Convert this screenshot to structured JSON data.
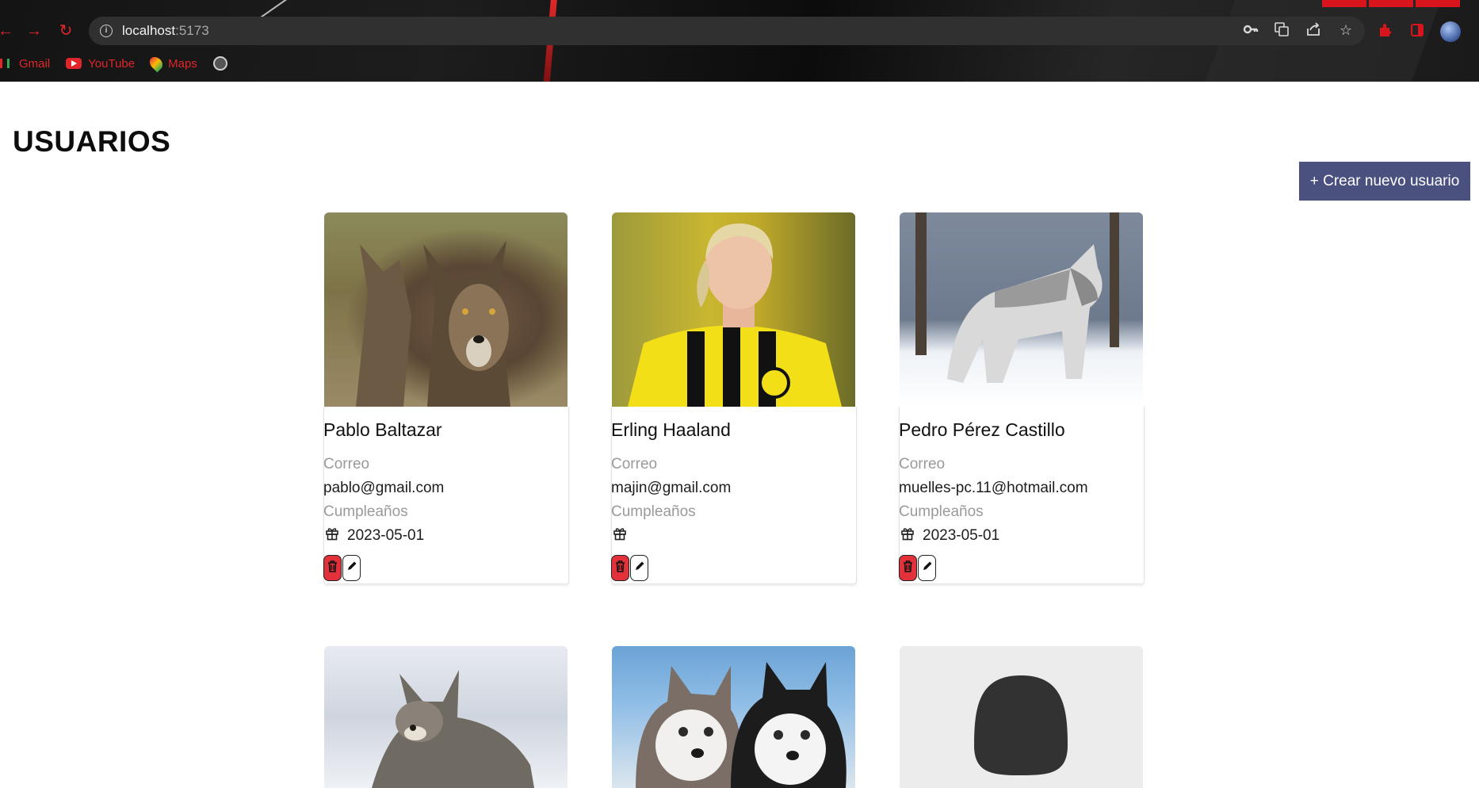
{
  "browser": {
    "url_host": "localhost",
    "url_port": ":5173",
    "bookmarks": [
      {
        "label": "Gmail",
        "icon": "gmail-icon"
      },
      {
        "label": "YouTube",
        "icon": "youtube-icon"
      },
      {
        "label": "Maps",
        "icon": "maps-icon"
      }
    ]
  },
  "page": {
    "title": "USUARIOS",
    "create_button": "+ Crear nuevo usuario"
  },
  "labels": {
    "email": "Correo",
    "birthday": "Cumpleaños"
  },
  "users": [
    {
      "name": "Pablo Baltazar",
      "email": "pablo@gmail.com",
      "birthday": "2023-05-01",
      "photo": "wolf"
    },
    {
      "name": "Erling Haaland",
      "email": "majin@gmail.com",
      "birthday": "",
      "photo": "footballer"
    },
    {
      "name": "Pedro Pérez Castillo",
      "email": "muelles-pc.11@hotmail.com",
      "birthday": "2023-05-01",
      "photo": "wolf-in-snow"
    },
    {
      "photo": "wolf-in-snow"
    },
    {
      "photo": "husky-puppies"
    },
    {
      "photo": "default-avatar"
    }
  ],
  "colors": {
    "accent_button": "#4a517e",
    "delete_button": "#e2313a",
    "label_gray": "#9a9a9a"
  }
}
